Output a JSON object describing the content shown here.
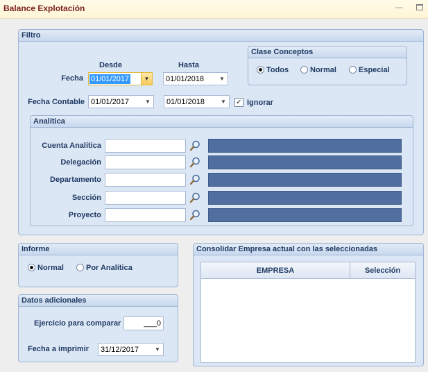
{
  "window": {
    "title": "Balance Explotación"
  },
  "filtro": {
    "title": "Filtro",
    "desde_label": "Desde",
    "hasta_label": "Hasta",
    "fecha_label": "Fecha",
    "fecha_desde": "01/01/2017",
    "fecha_hasta": "01/01/2018",
    "fecha_contable_label": "Fecha Contable",
    "fecha_contable_desde": "01/01/2017",
    "fecha_contable_hasta": "01/01/2018",
    "ignorar_label": "Ignorar",
    "ignorar_checked": true,
    "clase": {
      "title": "Clase Conceptos",
      "options": [
        "Todos",
        "Normal",
        "Especial"
      ],
      "selected": "Todos"
    },
    "analitica": {
      "title": "Analítica",
      "rows": [
        {
          "label": "Cuenta Analítica"
        },
        {
          "label": "Delegación"
        },
        {
          "label": "Departamento"
        },
        {
          "label": "Sección"
        },
        {
          "label": "Proyecto"
        }
      ]
    }
  },
  "informe": {
    "title": "Informe",
    "options": [
      "Normal",
      "Por Analítica"
    ],
    "selected": "Normal"
  },
  "datos": {
    "title": "Datos adicionales",
    "ejercicio_label": "Ejercicio para comparar",
    "ejercicio_value": "___0",
    "fecha_imprimir_label": "Fecha a imprimir",
    "fecha_imprimir_value": "31/12/2017"
  },
  "consolidar": {
    "title": "Consolidar Empresa actual con las seleccionadas",
    "columns": [
      "EMPRESA",
      "Selección"
    ],
    "rows": []
  },
  "icons": {
    "dropdown": "chevron-down-icon",
    "search": "magnifier-icon",
    "minimize": "minimize-icon",
    "maximize": "maximize-icon"
  }
}
